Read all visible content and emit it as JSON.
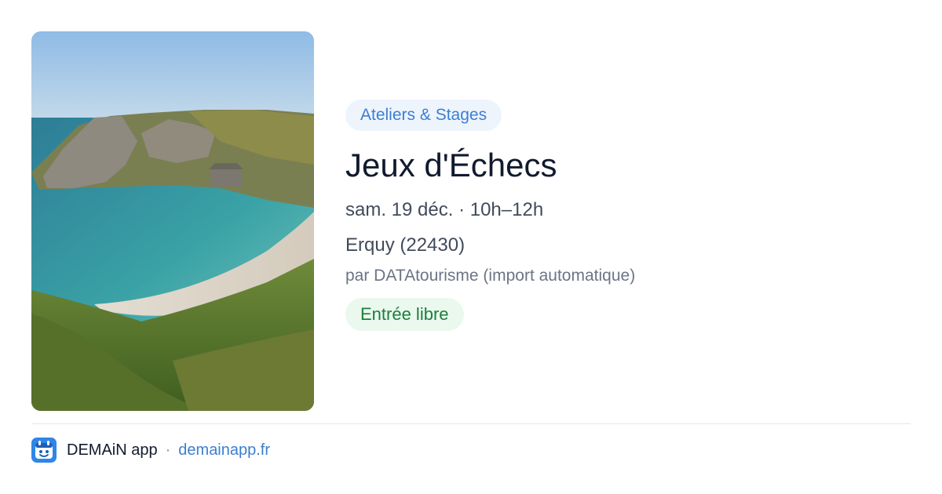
{
  "event": {
    "category": "Ateliers & Stages",
    "title": "Jeux d'Échecs",
    "datetime": "sam. 19 déc. · 10h–12h",
    "location": "Erquy (22430)",
    "organizer": "par DATAtourisme (import automatique)",
    "price": "Entrée libre",
    "image_icon": "coastal-cove-photo"
  },
  "footer": {
    "app_name": "DEMAiN app",
    "separator": "·",
    "url": "demainapp.fr",
    "logo_icon": "demain-app-logo"
  },
  "colors": {
    "accent": "#3b7fd1",
    "category_bg": "#eef4fc",
    "price_text": "#1b7f3c",
    "price_bg": "#eaf8ee",
    "title": "#111a2e"
  }
}
